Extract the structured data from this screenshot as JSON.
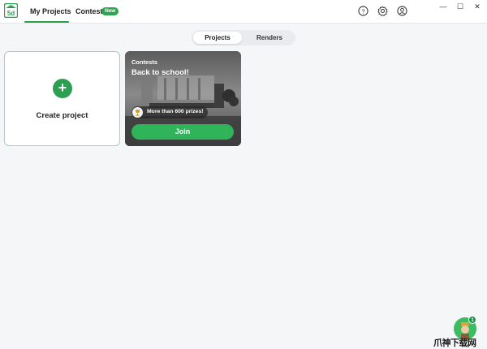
{
  "app": {
    "logo_text": "5d",
    "accent": "#2e9e53"
  },
  "header": {
    "tabs": [
      {
        "label": "My Projects",
        "active": true
      },
      {
        "label": "Contests",
        "badge": "New"
      }
    ],
    "icons": [
      "help-icon",
      "settings-icon",
      "account-icon"
    ],
    "window_controls": [
      "minimize",
      "maximize",
      "close"
    ],
    "window_glyphs": {
      "minimize": "—",
      "maximize": "☐",
      "close": "✕"
    }
  },
  "segmented": {
    "options": [
      "Projects",
      "Renders"
    ],
    "selected": "Projects"
  },
  "create_card": {
    "plus": "+",
    "label": "Create project"
  },
  "contest_card": {
    "category": "Contests",
    "title": "Back to school!",
    "prize_text": "More than 600 prizes!",
    "join_label": "Join"
  },
  "assistant": {
    "badge_count": "1"
  },
  "watermark": {
    "text": "爪神下载网"
  }
}
